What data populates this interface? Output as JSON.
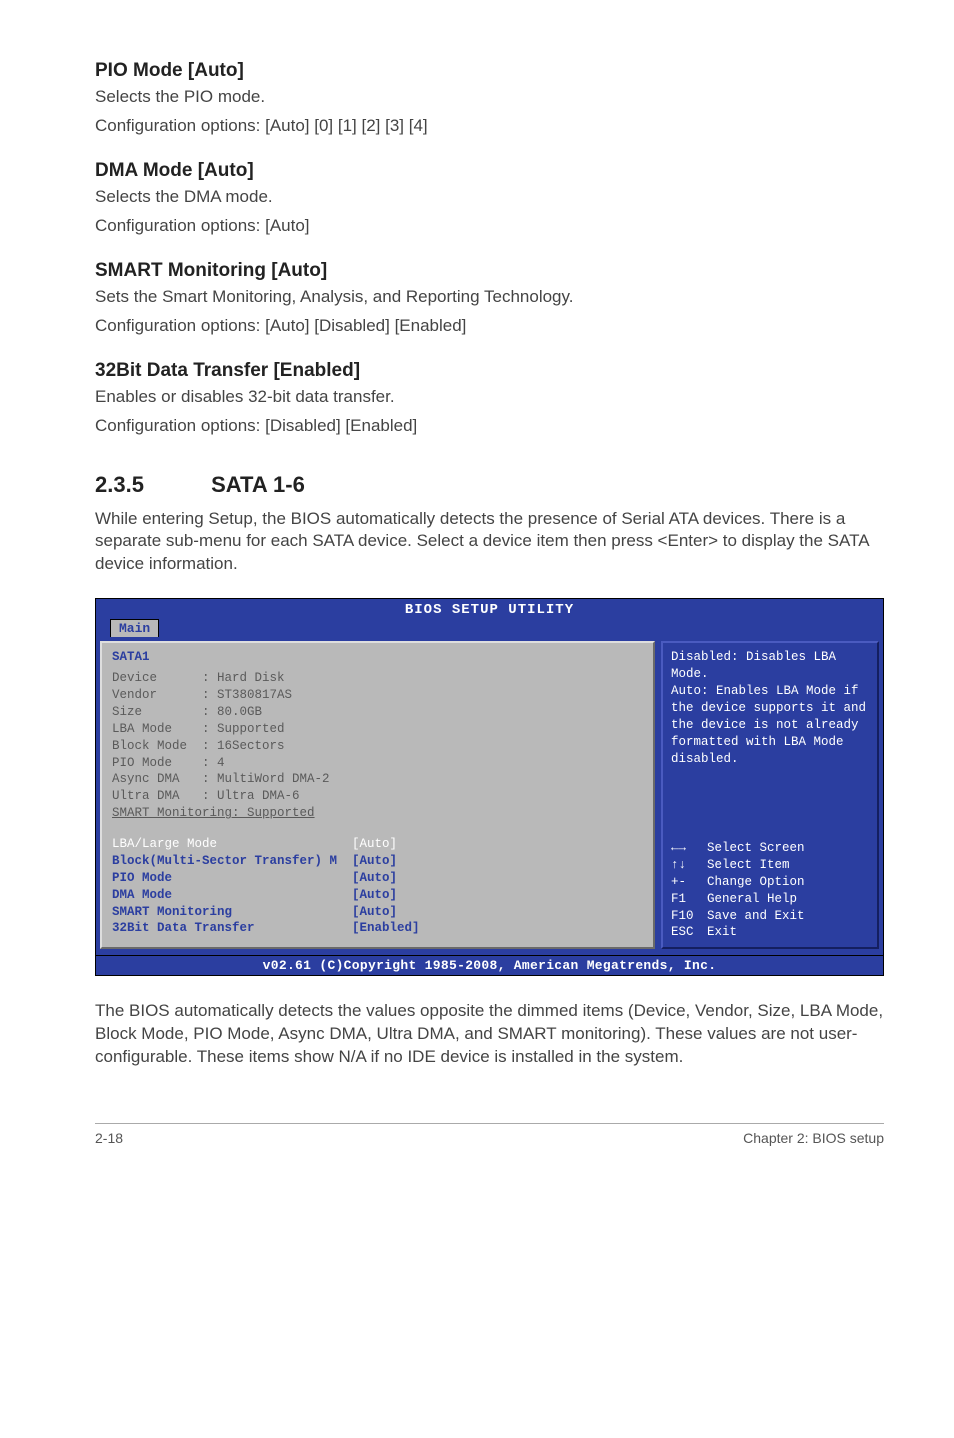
{
  "sections": {
    "pio": {
      "heading": "PIO Mode [Auto]",
      "lines": [
        "Selects the PIO mode.",
        "Configuration options: [Auto] [0] [1] [2] [3] [4]"
      ]
    },
    "dma": {
      "heading": "DMA Mode [Auto]",
      "lines": [
        "Selects the DMA mode.",
        "Configuration options: [Auto]"
      ]
    },
    "smart": {
      "heading": "SMART Monitoring [Auto]",
      "lines": [
        "Sets the Smart Monitoring, Analysis, and Reporting Technology.",
        "Configuration options: [Auto] [Disabled] [Enabled]"
      ]
    },
    "xfer": {
      "heading": "32Bit Data Transfer [Enabled]",
      "lines": [
        "Enables or disables 32-bit data transfer.",
        "Configuration options: [Disabled] [Enabled]"
      ]
    }
  },
  "sata_section": {
    "number": "2.3.5",
    "title": "SATA 1-6",
    "intro": "While entering Setup, the BIOS automatically detects the presence of Serial ATA devices. There is a separate sub-menu for each SATA device. Select a device item then press <Enter> to display the SATA device information.",
    "outro": "The BIOS automatically detects the values opposite the dimmed items (Device, Vendor, Size, LBA Mode, Block Mode, PIO Mode, Async DMA, Ultra DMA, and SMART monitoring). These values are not user-configurable. These items show N/A if no IDE device is installed in the system."
  },
  "bios": {
    "title": "BIOS SETUP UTILITY",
    "tab": "Main",
    "panel_header": "SATA1",
    "info_rows": [
      {
        "label": "Device",
        "value": ": Hard Disk"
      },
      {
        "label": "Vendor",
        "value": ": ST380817AS"
      },
      {
        "label": "Size",
        "value": ": 80.0GB"
      },
      {
        "label": "LBA Mode",
        "value": ": Supported"
      },
      {
        "label": "Block Mode",
        "value": ": 16Sectors"
      },
      {
        "label": "PIO Mode",
        "value": ": 4"
      },
      {
        "label": "Async DMA",
        "value": ": MultiWord DMA-2"
      },
      {
        "label": "Ultra DMA",
        "value": ": Ultra DMA-6"
      }
    ],
    "info_footer": "SMART Monitoring: Supported",
    "settings": [
      {
        "label": "LBA/Large Mode",
        "value": "[Auto]",
        "selected": true
      },
      {
        "label": "Block(Multi-Sector Transfer) M",
        "value": "[Auto]",
        "selected": false
      },
      {
        "label": "PIO Mode",
        "value": "[Auto]",
        "selected": false
      },
      {
        "label": "DMA Mode",
        "value": "[Auto]",
        "selected": false
      },
      {
        "label": "SMART Monitoring",
        "value": "[Auto]",
        "selected": false
      },
      {
        "label": "32Bit Data Transfer",
        "value": "[Enabled]",
        "selected": false
      }
    ],
    "help_text": "Disabled: Disables LBA Mode.\nAuto: Enables LBA Mode if the device supports it and the device is not already formatted with LBA Mode disabled.",
    "legend": [
      {
        "key": "←→",
        "label": "Select Screen"
      },
      {
        "key": "↑↓",
        "label": "Select Item"
      },
      {
        "key": "+-",
        "label": "Change Option"
      },
      {
        "key": "F1",
        "label": "General Help"
      },
      {
        "key": "F10",
        "label": "Save and Exit"
      },
      {
        "key": "ESC",
        "label": "Exit"
      }
    ],
    "footer": "v02.61 (C)Copyright 1985-2008, American Megatrends, Inc."
  },
  "page_footer": {
    "left": "2-18",
    "right": "Chapter 2: BIOS setup"
  }
}
